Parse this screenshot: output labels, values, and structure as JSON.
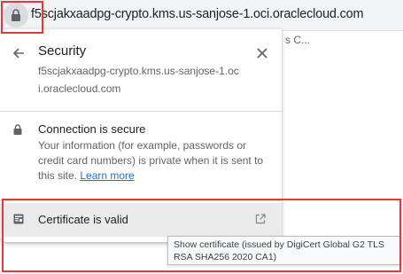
{
  "address_bar": {
    "url": "f5scjakxaadpg-crypto.kms.us-sanjose-1.oci.oraclecloud.com",
    "lock_icon": "lock-icon"
  },
  "background": {
    "tab_fragment": "s C..."
  },
  "popup": {
    "title": "Security",
    "host": "f5scjakxaadpg-crypto.kms.us-sanjose-1.oci.oraclecloud.com",
    "back_icon": "arrow-left-icon",
    "close_icon": "close-icon",
    "connection": {
      "title": "Connection is secure",
      "description": "Your information (for example, passwords or credit card numbers) is private when it is sent to this site.",
      "learn_more": "Learn more"
    },
    "certificate": {
      "label": "Certificate is valid",
      "icon": "certificate-icon",
      "external_icon": "open-external-icon"
    }
  },
  "tooltip": {
    "text": "Show certificate (issued by DigiCert Global G2 TLS RSA SHA256 2020 CA1)"
  },
  "colors": {
    "highlight": "#e53935",
    "link": "#1a73e8",
    "row_hover": "#ebebeb"
  }
}
